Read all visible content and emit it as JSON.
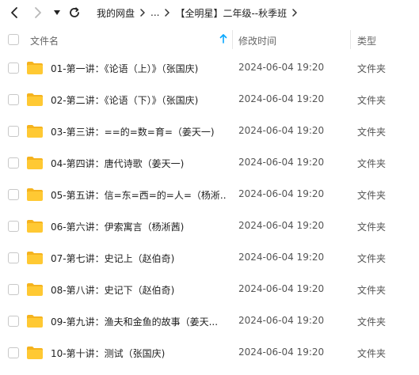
{
  "breadcrumb": [
    "我的网盘",
    "...",
    "【全明星】二年级--秋季班"
  ],
  "header": {
    "name": "文件名",
    "modified": "修改时间",
    "type": "类型"
  },
  "files": [
    {
      "name": "01-第一讲：《论语（上）》（张国庆)",
      "modified": "2024-06-04 19:20",
      "type": "文件夹"
    },
    {
      "name": "02-第二讲：《论语（下）》（张国庆)",
      "modified": "2024-06-04 19:20",
      "type": "文件夹"
    },
    {
      "name": "03-第三讲：==的=数=育=（姜天一)",
      "modified": "2024-06-04 19:20",
      "type": "文件夹"
    },
    {
      "name": "04-第四讲：唐代诗歌（姜天一)",
      "modified": "2024-06-04 19:20",
      "type": "文件夹"
    },
    {
      "name": "05-第五讲：信=东=西=的=人=（杨淅...",
      "modified": "2024-06-04 19:20",
      "type": "文件夹"
    },
    {
      "name": "06-第六讲：伊索寓言（杨淅茜)",
      "modified": "2024-06-04 19:20",
      "type": "文件夹"
    },
    {
      "name": "07-第七讲：史记上（赵伯奇)",
      "modified": "2024-06-04 19:20",
      "type": "文件夹"
    },
    {
      "name": "08-第八讲：史记下（赵伯奇)",
      "modified": "2024-06-04 19:20",
      "type": "文件夹"
    },
    {
      "name": "09-第九讲：渔夫和金鱼的故事（姜天...",
      "modified": "2024-06-04 19:20",
      "type": "文件夹"
    },
    {
      "name": "10-第十讲：测试（张国庆)",
      "modified": "2024-06-04 19:20",
      "type": "文件夹"
    }
  ],
  "colors": {
    "folder": "#FFC933",
    "folder_tab": "#F5B31E",
    "accent": "#06A7FF"
  },
  "icons": {
    "back": "chevron-left-icon",
    "forward": "chevron-right-icon",
    "menu": "caret-down-icon",
    "refresh": "refresh-icon",
    "sort": "sort-arrow-up-icon",
    "folder": "folder-icon"
  }
}
